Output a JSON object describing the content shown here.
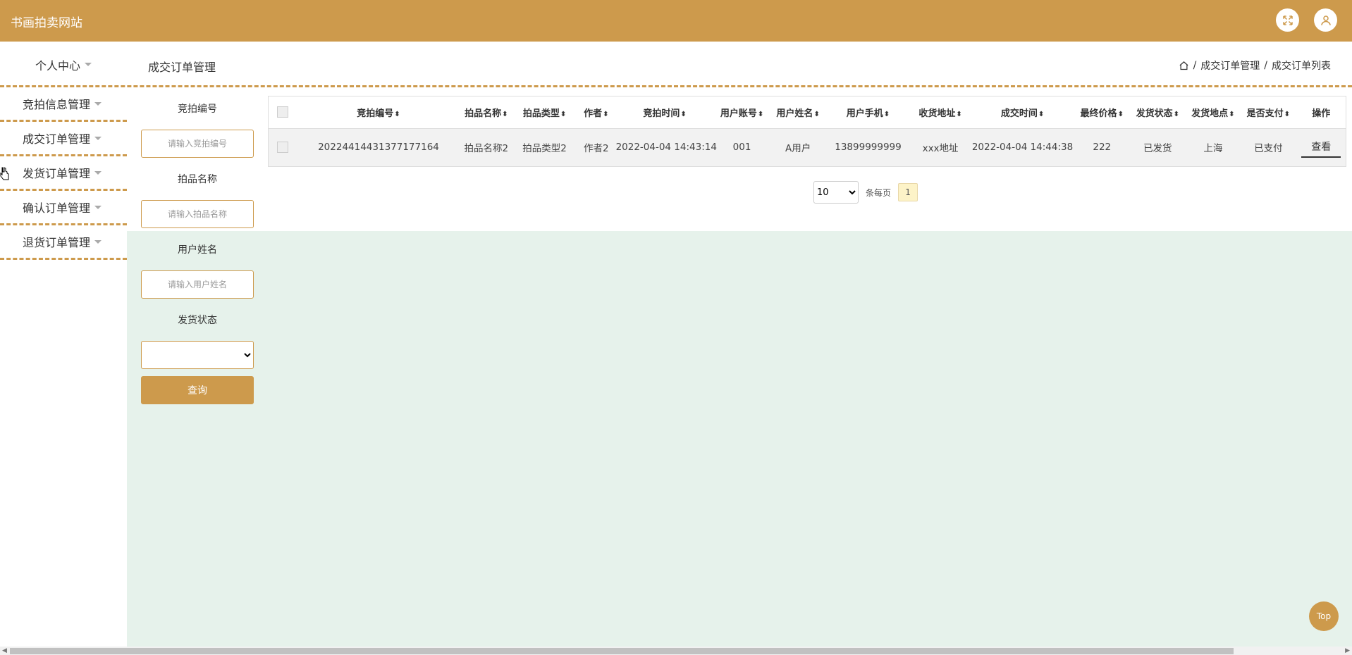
{
  "header": {
    "site_title": "书画拍卖网站",
    "fullscreen_icon": "expand-icon",
    "user_icon": "user-icon",
    "brand_color": "#cd9a4c"
  },
  "sidebar": {
    "items": [
      {
        "label": "个人中心"
      },
      {
        "label": "竞拍信息管理"
      },
      {
        "label": "成交订单管理"
      },
      {
        "label": "发货订单管理"
      },
      {
        "label": "确认订单管理"
      },
      {
        "label": "退货订单管理"
      }
    ]
  },
  "page": {
    "title": "成交订单管理",
    "breadcrumb": [
      "成交订单管理",
      "成交订单列表"
    ],
    "breadcrumb_sep": "/"
  },
  "search": {
    "bid_no_label": "竞拍编号",
    "bid_no_placeholder": "请输入竞拍编号",
    "item_name_label": "拍品名称",
    "item_name_placeholder": "请输入拍品名称",
    "user_name_label": "用户姓名",
    "user_name_placeholder": "请输入用户姓名",
    "ship_status_label": "发货状态",
    "ship_status_value": "",
    "query_button": "查询"
  },
  "table": {
    "columns": [
      "竞拍编号",
      "拍品名称",
      "拍品类型",
      "作者",
      "竞拍时间",
      "用户账号",
      "用户姓名",
      "用户手机",
      "收货地址",
      "成交时间",
      "最终价格",
      "发货状态",
      "发货地点",
      "是否支付",
      "操作"
    ],
    "rows": [
      {
        "bid_no": "20224414431377177164",
        "item_name": "拍品名称2",
        "item_type": "拍品类型2",
        "author": "作者2",
        "bid_time": "2022-04-04 14:43:14",
        "account": "001",
        "user_name": "A用户",
        "phone": "13899999999",
        "address": "xxx地址",
        "deal_time": "2022-04-04 14:44:38",
        "final_price": "222",
        "ship_status": "已发货",
        "ship_place": "上海",
        "paid": "已支付",
        "action": "查看"
      }
    ]
  },
  "pagination": {
    "page_size": "10",
    "per_page_label": "条每页",
    "current_page": "1"
  },
  "top_button": "Top"
}
